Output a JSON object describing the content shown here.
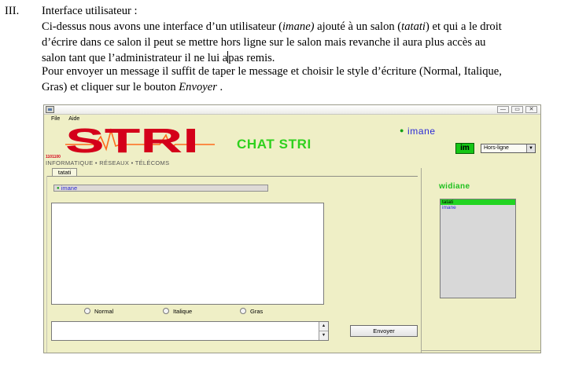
{
  "doc": {
    "section_number": "III.",
    "section_title": "Interface utilisateur :",
    "para1": [
      {
        "parts": [
          {
            "t": "Ci-dessus nous avons une interface d’un utilisateur ("
          },
          {
            "t": "imane)",
            "i": true
          },
          {
            "t": " ajouté à un salon ("
          },
          {
            "t": "tatati",
            "i": true
          },
          {
            "t": ") et qui a le droit"
          }
        ]
      },
      {
        "parts": [
          {
            "t": "d’écrire dans ce salon il peut se mettre hors ligne sur le salon mais revanche il aura plus accès au"
          }
        ]
      },
      {
        "parts": [
          {
            "t": "salon tant que l’administrateur il ne lui a"
          },
          {
            "cursor": true
          },
          {
            "t": "pas remis."
          }
        ]
      }
    ],
    "para2": [
      {
        "parts": [
          {
            "t": "Pour envoyer un message il suffit de taper le message et choisir le style d’écriture (Normal, Italique,"
          }
        ]
      },
      {
        "parts": [
          {
            "t": "Gras) et cliquer sur le bouton "
          },
          {
            "t": "Envoyer",
            "i": true
          },
          {
            "t": " ."
          }
        ]
      }
    ]
  },
  "app": {
    "window_buttons": [
      "—",
      "▭",
      "✕"
    ],
    "menu": [
      "File",
      "Aide"
    ],
    "logo_text": "STRI",
    "logo_bits": "1101100",
    "tagline": "INFORMATIQUE • RÉSEAUX • TÉLÉCOMS",
    "chat_title": "CHAT STRI",
    "current_user": "imane",
    "im_badge": "im",
    "status": {
      "selected": "Hors-ligne"
    },
    "room_tab": "tatati",
    "present_user": "imane",
    "styles": [
      "Normal",
      "Italique",
      "Gras"
    ],
    "send_button": "Envoyer",
    "panel_user": "widiane",
    "room_list": [
      {
        "label": "tatati",
        "selected": true
      },
      {
        "label": "imane",
        "selected": false
      }
    ],
    "colors": {
      "window_bg": "#efefc6",
      "logo_red": "#d4001a",
      "logo_orange": "#ff6a1a",
      "title_green": "#2fd11e",
      "user_blue": "#2b2bd6",
      "selected_green": "#22d422"
    }
  }
}
